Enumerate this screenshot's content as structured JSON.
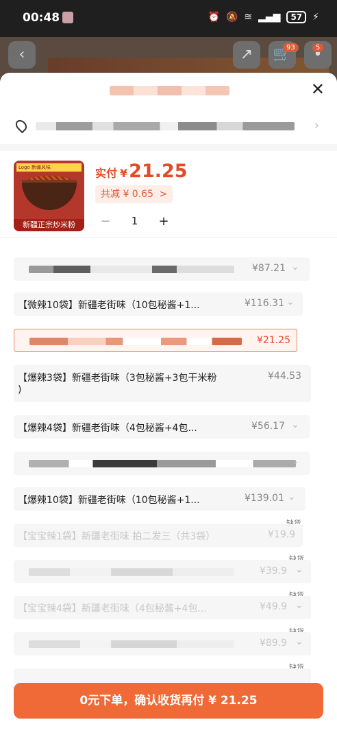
{
  "status_bar": {
    "time": "00:48",
    "battery": "57"
  },
  "background_page": {
    "cart_badge": "93",
    "msg_badge": "5"
  },
  "summary": {
    "price_label": "实付",
    "currency": "¥",
    "price": "21.25",
    "discount": "共减 ¥ 0.65",
    "discount_chevron": ">",
    "quantity": "1",
    "minus": "−",
    "plus": "+",
    "product_caption": "新疆正宗炒米粉",
    "product_tag": "Logo 新疆风味"
  },
  "options": [
    {
      "label": "",
      "price": "¥87.21",
      "state": "normal",
      "blurred": true
    },
    {
      "label": "【微辣10袋】新疆老街味（10包秘酱+1...",
      "price": "¥116.31",
      "state": "normal",
      "blurred": false
    },
    {
      "label": "",
      "price": "¥21.25",
      "state": "selected",
      "blurred": true
    },
    {
      "label": "【爆辣3袋】新疆老街味（3包秘酱+3包干米粉",
      "label2": ")",
      "price": "¥44.53",
      "state": "normal",
      "blurred": false
    },
    {
      "label": "【爆辣4袋】新疆老街味（4包秘酱+4包...",
      "price": "¥56.17",
      "state": "normal",
      "blurred": false
    },
    {
      "label": "",
      "price": "",
      "state": "normal",
      "blurred": true
    },
    {
      "label": "【爆辣10袋】新疆老街味（10包秘酱+1...",
      "price": "¥139.01",
      "state": "normal",
      "blurred": false
    },
    {
      "label": "【宝宝辣1袋】新疆老街味 拍二发三（共3袋）",
      "price": "¥19.9",
      "state": "disabled",
      "blurred": false,
      "oos": "缺货"
    },
    {
      "label": "",
      "price": "¥39.9",
      "state": "disabled",
      "blurred": true,
      "oos": "缺货"
    },
    {
      "label": "【宝宝辣4袋】新疆老街味（4包秘酱+4包...",
      "price": "¥49.9",
      "state": "disabled",
      "blurred": false,
      "oos": "缺货"
    },
    {
      "label": "",
      "price": "¥89.9",
      "state": "disabled",
      "blurred": true,
      "oos": "缺货"
    }
  ],
  "last_oos": "缺货",
  "action": {
    "label": "0元下单，确认收货再付 ¥ 21.25"
  },
  "colors": {
    "accent": "#ef6a37",
    "price_red": "#e24a2a"
  }
}
